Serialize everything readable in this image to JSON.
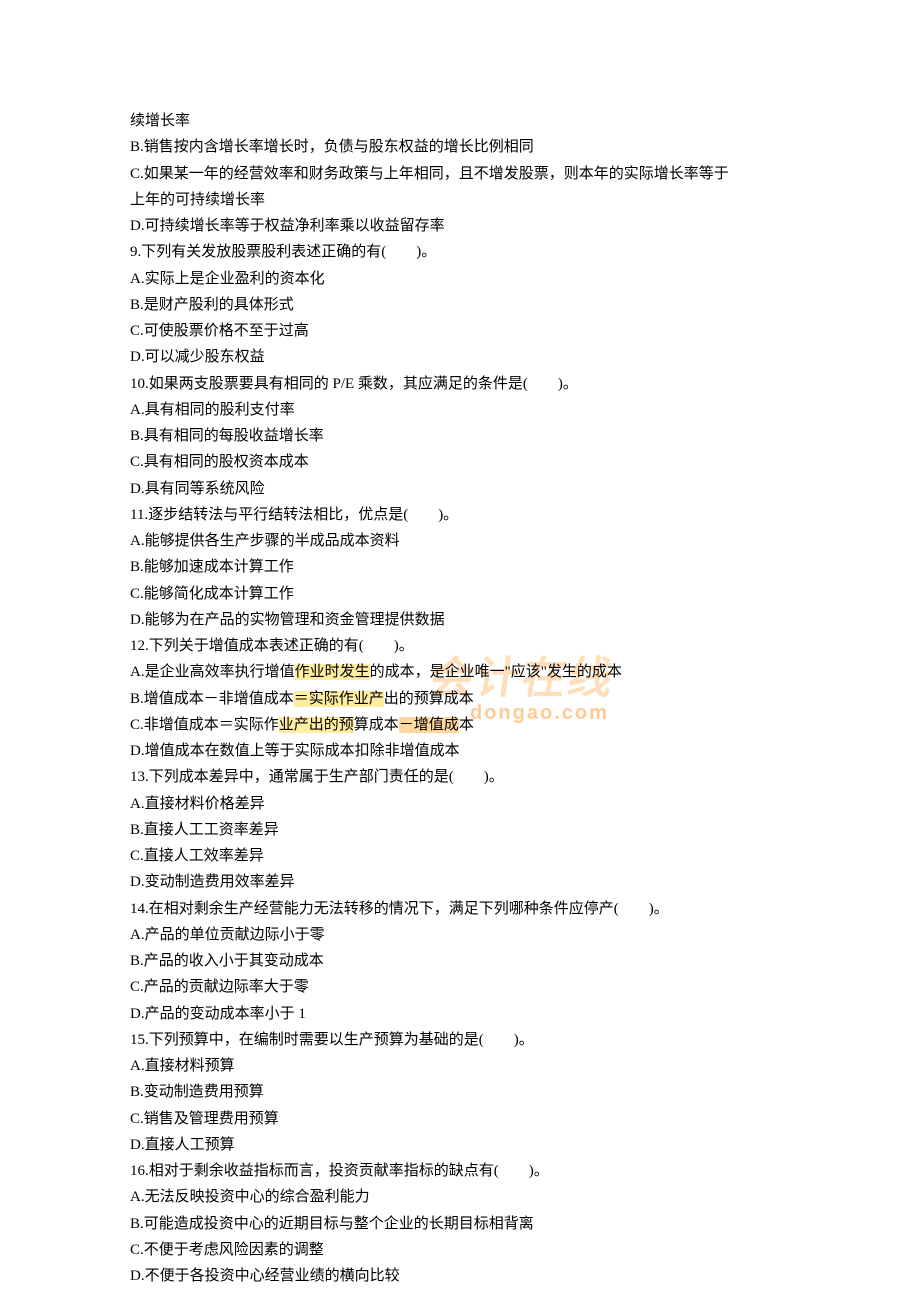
{
  "lines": [
    "续增长率",
    "B.销售按内含增长率增长时，负债与股东权益的增长比例相同",
    "C.如果某一年的经营效率和财务政策与上年相同，且不增发股票，则本年的实际增长率等于",
    "上年的可持续增长率",
    "D.可持续增长率等于权益净利率乘以收益留存率",
    "9.下列有关发放股票股利表述正确的有(　　)。",
    "A.实际上是企业盈利的资本化",
    "B.是财产股利的具体形式",
    "C.可使股票价格不至于过高",
    "D.可以减少股东权益",
    "10.如果两支股票要具有相同的 P/E 乘数，其应满足的条件是(　　)。",
    "A.具有相同的股利支付率",
    "B.具有相同的每股收益增长率",
    "C.具有相同的股权资本成本",
    "D.具有同等系统风险",
    "11.逐步结转法与平行结转法相比，优点是(　　)。",
    "A.能够提供各生产步骤的半成品成本资料",
    "B.能够加速成本计算工作",
    "C.能够简化成本计算工作",
    "D.能够为在产品的实物管理和资金管理提供数据",
    "12.下列关于增值成本表述正确的有(　　)。",
    "A.是企业高效率执行增值作业时发生的成本，是企业唯一\"应该\"发生的成本",
    "B.增值成本－非增值成本＝实际作业产出的预算成本",
    "C.非增值成本＝实际作业产出的预算成本－增值成本",
    "D.增值成本在数值上等于实际成本扣除非增值成本",
    "13.下列成本差异中，通常属于生产部门责任的是(　　)。",
    "A.直接材料价格差异",
    "B.直接人工工资率差异",
    "C.直接人工效率差异",
    "D.变动制造费用效率差异",
    "14.在相对剩余生产经营能力无法转移的情况下，满足下列哪种条件应停产(　　)。",
    "A.产品的单位贡献边际小于零",
    "B.产品的收入小于其变动成本",
    "C.产品的贡献边际率大于零",
    "D.产品的变动成本率小于 1",
    "15.下列预算中，在编制时需要以生产预算为基础的是(　　)。",
    "A.直接材料预算",
    "B.变动制造费用预算",
    "C.销售及管理费用预算",
    "D.直接人工预算",
    "16.相对于剩余收益指标而言，投资贡献率指标的缺点有(　　)。",
    "A.无法反映投资中心的综合盈利能力",
    "B.可能造成投资中心的近期目标与整个企业的长期目标相背离",
    "C.不便于考虑风险因素的调整",
    "D.不便于各投资中心经营业绩的横向比较"
  ],
  "highlights": {
    "21": [
      {
        "start": 12,
        "end": 17,
        "class": "hl-yellow"
      }
    ],
    "22": [
      {
        "start": 12,
        "end": 18,
        "class": "hl-yellow"
      }
    ],
    "23": [
      {
        "start": 11,
        "end": 16,
        "class": "hl-yellow"
      },
      {
        "start": 19,
        "end": 23,
        "class": "hl-orange"
      }
    ]
  },
  "watermark1": "会计在线",
  "watermark2": "dongao.com"
}
